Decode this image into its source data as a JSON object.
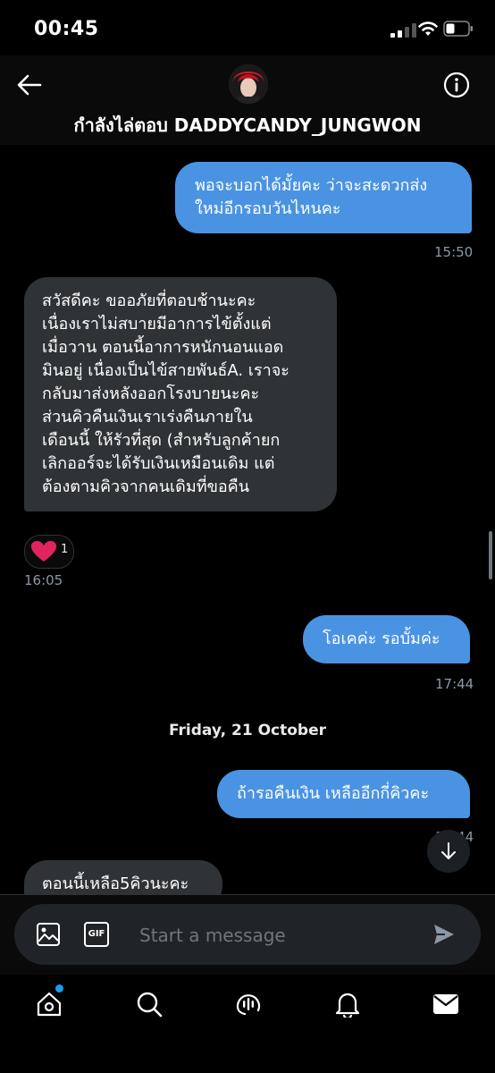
{
  "status": {
    "time": "00:45"
  },
  "header": {
    "title": "กำลังไล่ตอบ DADDYCANDY_JUNGWON"
  },
  "messages": [
    {
      "type": "sent",
      "text": "พอจะบอกได้มั้ยคะ ว่าจะสะดวกส่ง\nใหม่อีกรอบวันไหนคะ",
      "time": "15:50"
    },
    {
      "type": "received",
      "text": "สวัสดีคะ  ขออภัยที่ตอบช้านะคะ\nเนื่องเราไม่สบายมีอาการไข้ตั้งแต่\nเมื่อวาน ตอนนี้อาการหนักนอนแอด\nมินอยู่ เนื่องเป็นไข้สายพันธ์A. เราจะ\nกลับมาส่งหลังออกโรงบายนะคะ\nส่วนคิวคืนเงินเราเร่งคืนภายใน\nเดือนนี้ ให้รัวที่สุด (สำหรับลูกค้ายก\nเลิกออร์จะได้รับเงินเหมือนเดิม แต่\nต้องตามคิวจากคนเดิมที่ขอคืน",
      "time": "16:05",
      "reaction": {
        "emoji": "heart",
        "count": "1"
      }
    },
    {
      "type": "sent",
      "text": "โอเคค่ะ รอบั้มค่ะ",
      "time": "17:44"
    },
    {
      "type": "sent",
      "text": "ถ้ารอคืนเงิน เหลืออีกกี่คิวคะ",
      "time": "17:44"
    },
    {
      "type": "received",
      "text": "ตอนนี้เหลือ5คิวนะคะ"
    }
  ],
  "date_separator": "Friday, 21 October",
  "composer": {
    "placeholder": "Start a message",
    "gif_label": "GIF"
  },
  "tabs": [
    "home-icon",
    "search-icon",
    "spaces-icon",
    "notifications-icon",
    "messages-icon"
  ],
  "colors": {
    "sent_bubble": "#4a93e2",
    "received_bubble": "#2f3336",
    "background": "#000000",
    "accent": "#1d9bf0",
    "heart": "#e0245e"
  }
}
